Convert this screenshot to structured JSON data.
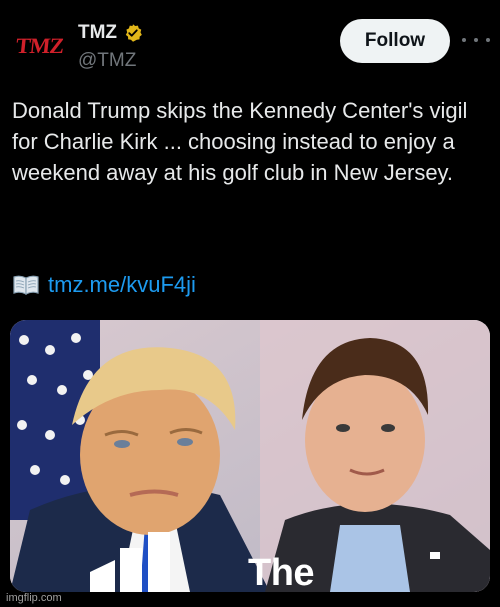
{
  "account": {
    "display_name": "TMZ",
    "handle": "@TMZ",
    "avatar_text": "TMZ",
    "verified_icon": "verified-gold-badge-icon"
  },
  "actions": {
    "follow_label": "Follow",
    "more_icon": "more-horizontal-icon"
  },
  "tweet": {
    "text": "Donald Trump skips the Kennedy Center's vigil for Charlie Kirk ... choosing instead to enjoy a weekend away at his golf club in New Jersey.",
    "link_icon": "open-book-icon",
    "link_text": "tmz.me/kvuF4ji"
  },
  "media": {
    "caption": "The"
  },
  "watermark": "imgflip.com",
  "colors": {
    "background": "#000000",
    "text": "#e7e9ea",
    "secondary_text": "#71767b",
    "link": "#1d9bf0",
    "verified": "#e2b719",
    "brand_red": "#d0202a"
  }
}
